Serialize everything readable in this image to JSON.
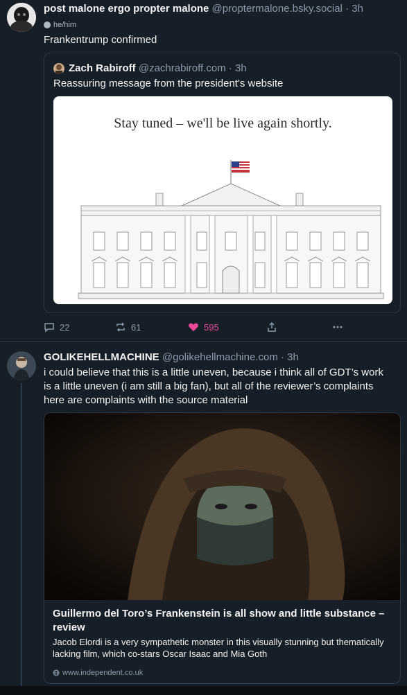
{
  "post1": {
    "author_name": "post malone ergo propter malone",
    "author_handle": "@proptermalone.bsky.social",
    "time_sep": " · ",
    "time": "3h",
    "pronouns": "he/him",
    "text": "Frankentrump confirmed",
    "quote": {
      "author_name": "Zach Rabiroff",
      "author_handle": "@zachrabiroff.com",
      "time_sep": " · ",
      "time": "3h",
      "text": "Reassuring message from the president's website",
      "image_text": "Stay tuned – we'll be live again shortly."
    },
    "actions": {
      "replies": "22",
      "reposts": "61",
      "likes": "595"
    }
  },
  "post2": {
    "author_name": "GOLIKEHELLMACHINE",
    "author_handle": "@golikehellmachine.com",
    "time_sep": " · ",
    "time": "3h",
    "text": "i could believe that this is a little uneven, because i think all of GDT’s work is a little uneven (i am still a big fan), but all of the reviewer’s complaints here are complaints with the source material",
    "link": {
      "title": "Guillermo del Toro’s Frankenstein is all show and little substance – review",
      "description": "Jacob Elordi is a very sympathetic monster in this visually stunning but thematically lacking film, which co-stars Oscar Isaac and Mia Goth",
      "domain": "www.independent.co.uk"
    }
  },
  "colors": {
    "background": "#161e27",
    "border": "#2e3a47",
    "muted_text": "#8c9aaa",
    "like_pink": "#ec4899"
  }
}
